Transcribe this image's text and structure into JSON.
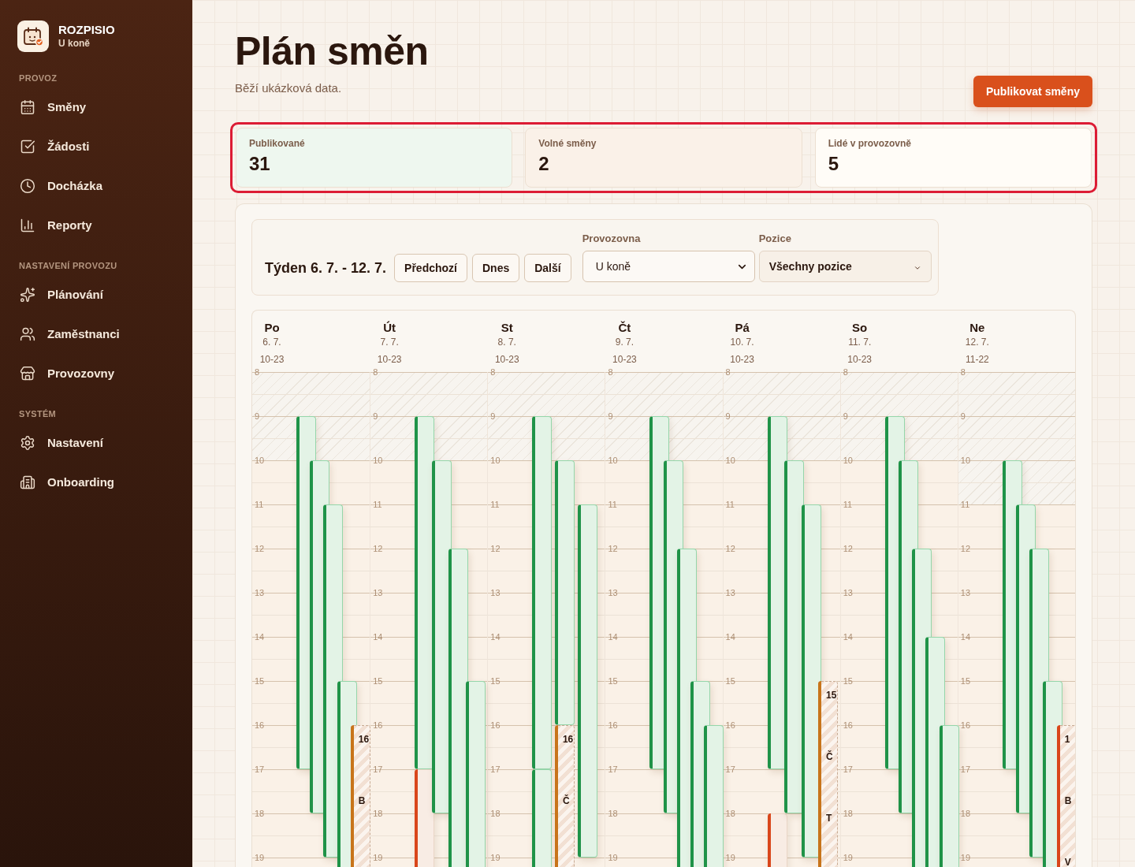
{
  "sidebar": {
    "brand": {
      "name": "ROZPISIO",
      "subtitle": "U koně"
    },
    "sections": [
      {
        "title": "PROVOZ",
        "items": [
          {
            "label": "Směny",
            "selected": false
          },
          {
            "label": "Žádosti",
            "selected": false
          },
          {
            "label": "Docházka",
            "selected": false
          },
          {
            "label": "Reporty",
            "selected": false
          }
        ]
      },
      {
        "title": "NASTAVENÍ PROVOZU",
        "items": [
          {
            "label": "Plánování",
            "selected": false
          },
          {
            "label": "Zaměstnanci",
            "selected": false
          },
          {
            "label": "Provozovny",
            "selected": false
          }
        ]
      },
      {
        "title": "SYSTÉM",
        "items": [
          {
            "label": "Nastavení",
            "selected": false
          },
          {
            "label": "Onboarding",
            "selected": false
          }
        ]
      }
    ]
  },
  "header": {
    "title": "Plán směn",
    "subtitle": "Běží ukázková data.",
    "publish_button": "Publikovat směny"
  },
  "stats": {
    "highlighted": true,
    "cards": [
      {
        "label": "Publikované",
        "value": "31"
      },
      {
        "label": "Volné směny",
        "value": "2"
      },
      {
        "label": "Lidé v provozovně",
        "value": "5"
      }
    ]
  },
  "toolbar": {
    "week_label": "Týden 6. 7. - 12. 7.",
    "nav_buttons": [
      "Předchozí",
      "Dnes",
      "Další"
    ],
    "filters": [
      {
        "kind": "select",
        "label": "Provozovna",
        "value": "U koně"
      },
      {
        "kind": "dropdown",
        "label": "Pozice",
        "value": "Všechny pozice"
      }
    ]
  },
  "calendar": {
    "days": [
      {
        "name": "Po",
        "date": "6. 7.",
        "hours": "10-23",
        "hour_labels": [
          "8",
          "9",
          "10",
          "11",
          "12",
          "13",
          "14",
          "15",
          "16",
          "17",
          "18",
          "19"
        ],
        "lanes": [
          [
            {
              "kind": "published"
            }
          ],
          [
            {
              "kind": "published"
            }
          ],
          [
            {
              "kind": "published"
            }
          ],
          [
            {
              "kind": "published"
            }
          ],
          [
            {
              "kind": "open",
              "color": "#c8741a",
              "lines": [
                "16",
                "B"
              ]
            }
          ]
        ]
      },
      {
        "name": "Út",
        "date": "7. 7.",
        "hours": "10-23",
        "hour_labels": [
          "8",
          "9",
          "10",
          "11",
          "12",
          "13",
          "14",
          "15",
          "16",
          "17",
          "18",
          "19"
        ],
        "lanes": [
          [
            {
              "kind": "published"
            },
            {
              "kind": "draft",
              "color": "#d9461b"
            }
          ],
          [
            {
              "kind": "published"
            }
          ],
          [
            {
              "kind": "published"
            }
          ],
          [
            {
              "kind": "published"
            }
          ]
        ]
      },
      {
        "name": "St",
        "date": "8. 7.",
        "hours": "10-23",
        "hour_labels": [
          "8",
          "9",
          "10",
          "11",
          "12",
          "13",
          "14",
          "15",
          "16",
          "17",
          "18",
          "19"
        ],
        "lanes": [
          [
            {
              "kind": "published"
            },
            {
              "kind": "published"
            }
          ],
          [
            {
              "kind": "published"
            },
            {
              "kind": "open",
              "color": "#c8741a",
              "lines": [
                "16",
                "Č"
              ]
            }
          ],
          [
            {
              "kind": "published"
            }
          ]
        ]
      },
      {
        "name": "Čt",
        "date": "9. 7.",
        "hours": "10-23",
        "hour_labels": [
          "8",
          "9",
          "10",
          "11",
          "12",
          "13",
          "14",
          "15",
          "16",
          "17",
          "18",
          "19"
        ],
        "lanes": [
          [
            {
              "kind": "published"
            }
          ],
          [
            {
              "kind": "published"
            }
          ],
          [
            {
              "kind": "published"
            }
          ],
          [
            {
              "kind": "published"
            }
          ],
          [
            {
              "kind": "published"
            }
          ]
        ]
      },
      {
        "name": "Pá",
        "date": "10. 7.",
        "hours": "10-23",
        "hour_labels": [
          "8",
          "9",
          "10",
          "11",
          "12",
          "13",
          "14",
          "15",
          "16",
          "17",
          "18",
          "19"
        ],
        "lanes": [
          [
            {
              "kind": "published"
            },
            {
              "kind": "draft",
              "color": "#d9461b"
            }
          ],
          [
            {
              "kind": "published"
            }
          ],
          [
            {
              "kind": "published"
            }
          ],
          [
            {
              "kind": "open",
              "color": "#c8741a",
              "lines": [
                "15",
                "Č",
                "T"
              ]
            }
          ]
        ]
      },
      {
        "name": "So",
        "date": "11. 7.",
        "hours": "10-23",
        "hour_labels": [
          "8",
          "9",
          "10",
          "11",
          "12",
          "13",
          "14",
          "15",
          "16",
          "17",
          "18",
          "19"
        ],
        "lanes": [
          [
            {
              "kind": "published"
            }
          ],
          [
            {
              "kind": "published"
            }
          ],
          [
            {
              "kind": "published"
            }
          ],
          [
            {
              "kind": "published"
            }
          ],
          [
            {
              "kind": "published"
            }
          ]
        ]
      },
      {
        "name": "Ne",
        "date": "12. 7.",
        "hours": "11-22",
        "hour_labels": [
          "8",
          "9",
          "10",
          "11",
          "12",
          "13",
          "14",
          "15",
          "16",
          "17",
          "18",
          "19"
        ],
        "lanes": [
          [
            {
              "kind": "published"
            }
          ],
          [
            {
              "kind": "published"
            }
          ],
          [
            {
              "kind": "published"
            }
          ],
          [
            {
              "kind": "published"
            }
          ],
          [
            {
              "kind": "open",
              "color": "#d9461b",
              "lines": [
                "1",
                "B",
                "V"
              ]
            }
          ]
        ]
      }
    ]
  }
}
